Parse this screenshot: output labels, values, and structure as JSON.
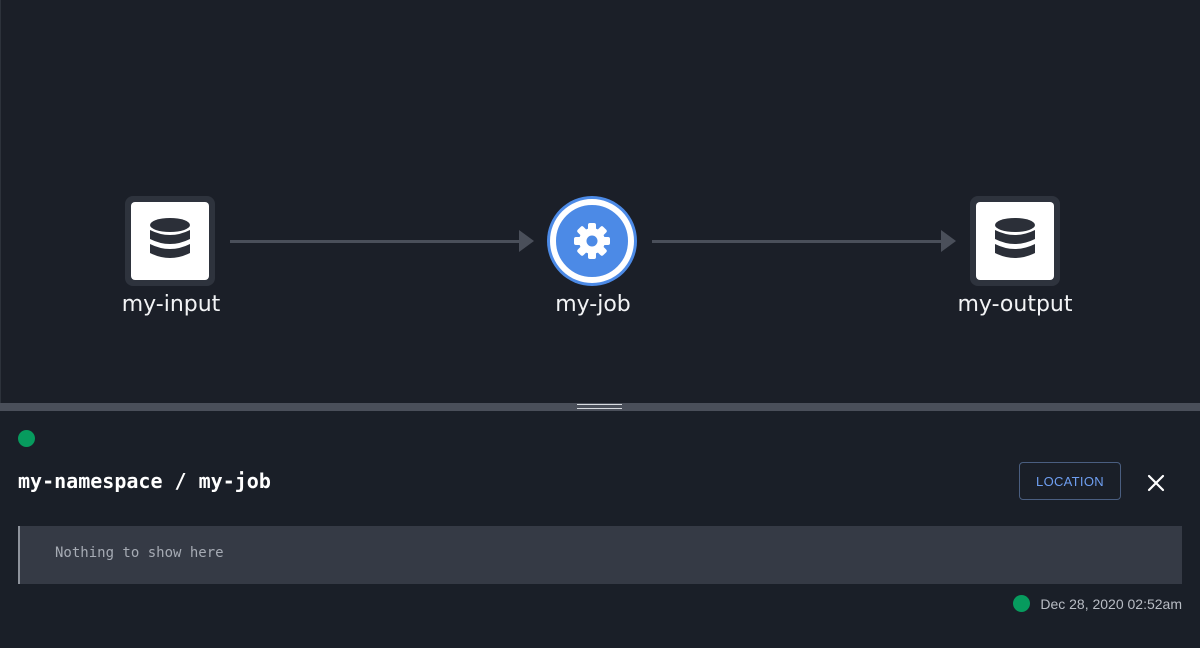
{
  "graph": {
    "nodes": [
      {
        "label": "my-input",
        "type": "dataset",
        "icon": "database-icon"
      },
      {
        "label": "my-job",
        "type": "job",
        "icon": "gear-icon"
      },
      {
        "label": "my-output",
        "type": "dataset",
        "icon": "database-icon"
      }
    ],
    "colors": {
      "job_accent": "#4c8ae6",
      "edge": "#4a4f5a"
    }
  },
  "panel": {
    "title": "my-namespace / my-job",
    "location_label": "LOCATION",
    "close_icon": "close-icon",
    "empty_text": "Nothing to show here",
    "timestamp": "Dec 28, 2020 02:52am",
    "status_color": "#079b5e"
  }
}
